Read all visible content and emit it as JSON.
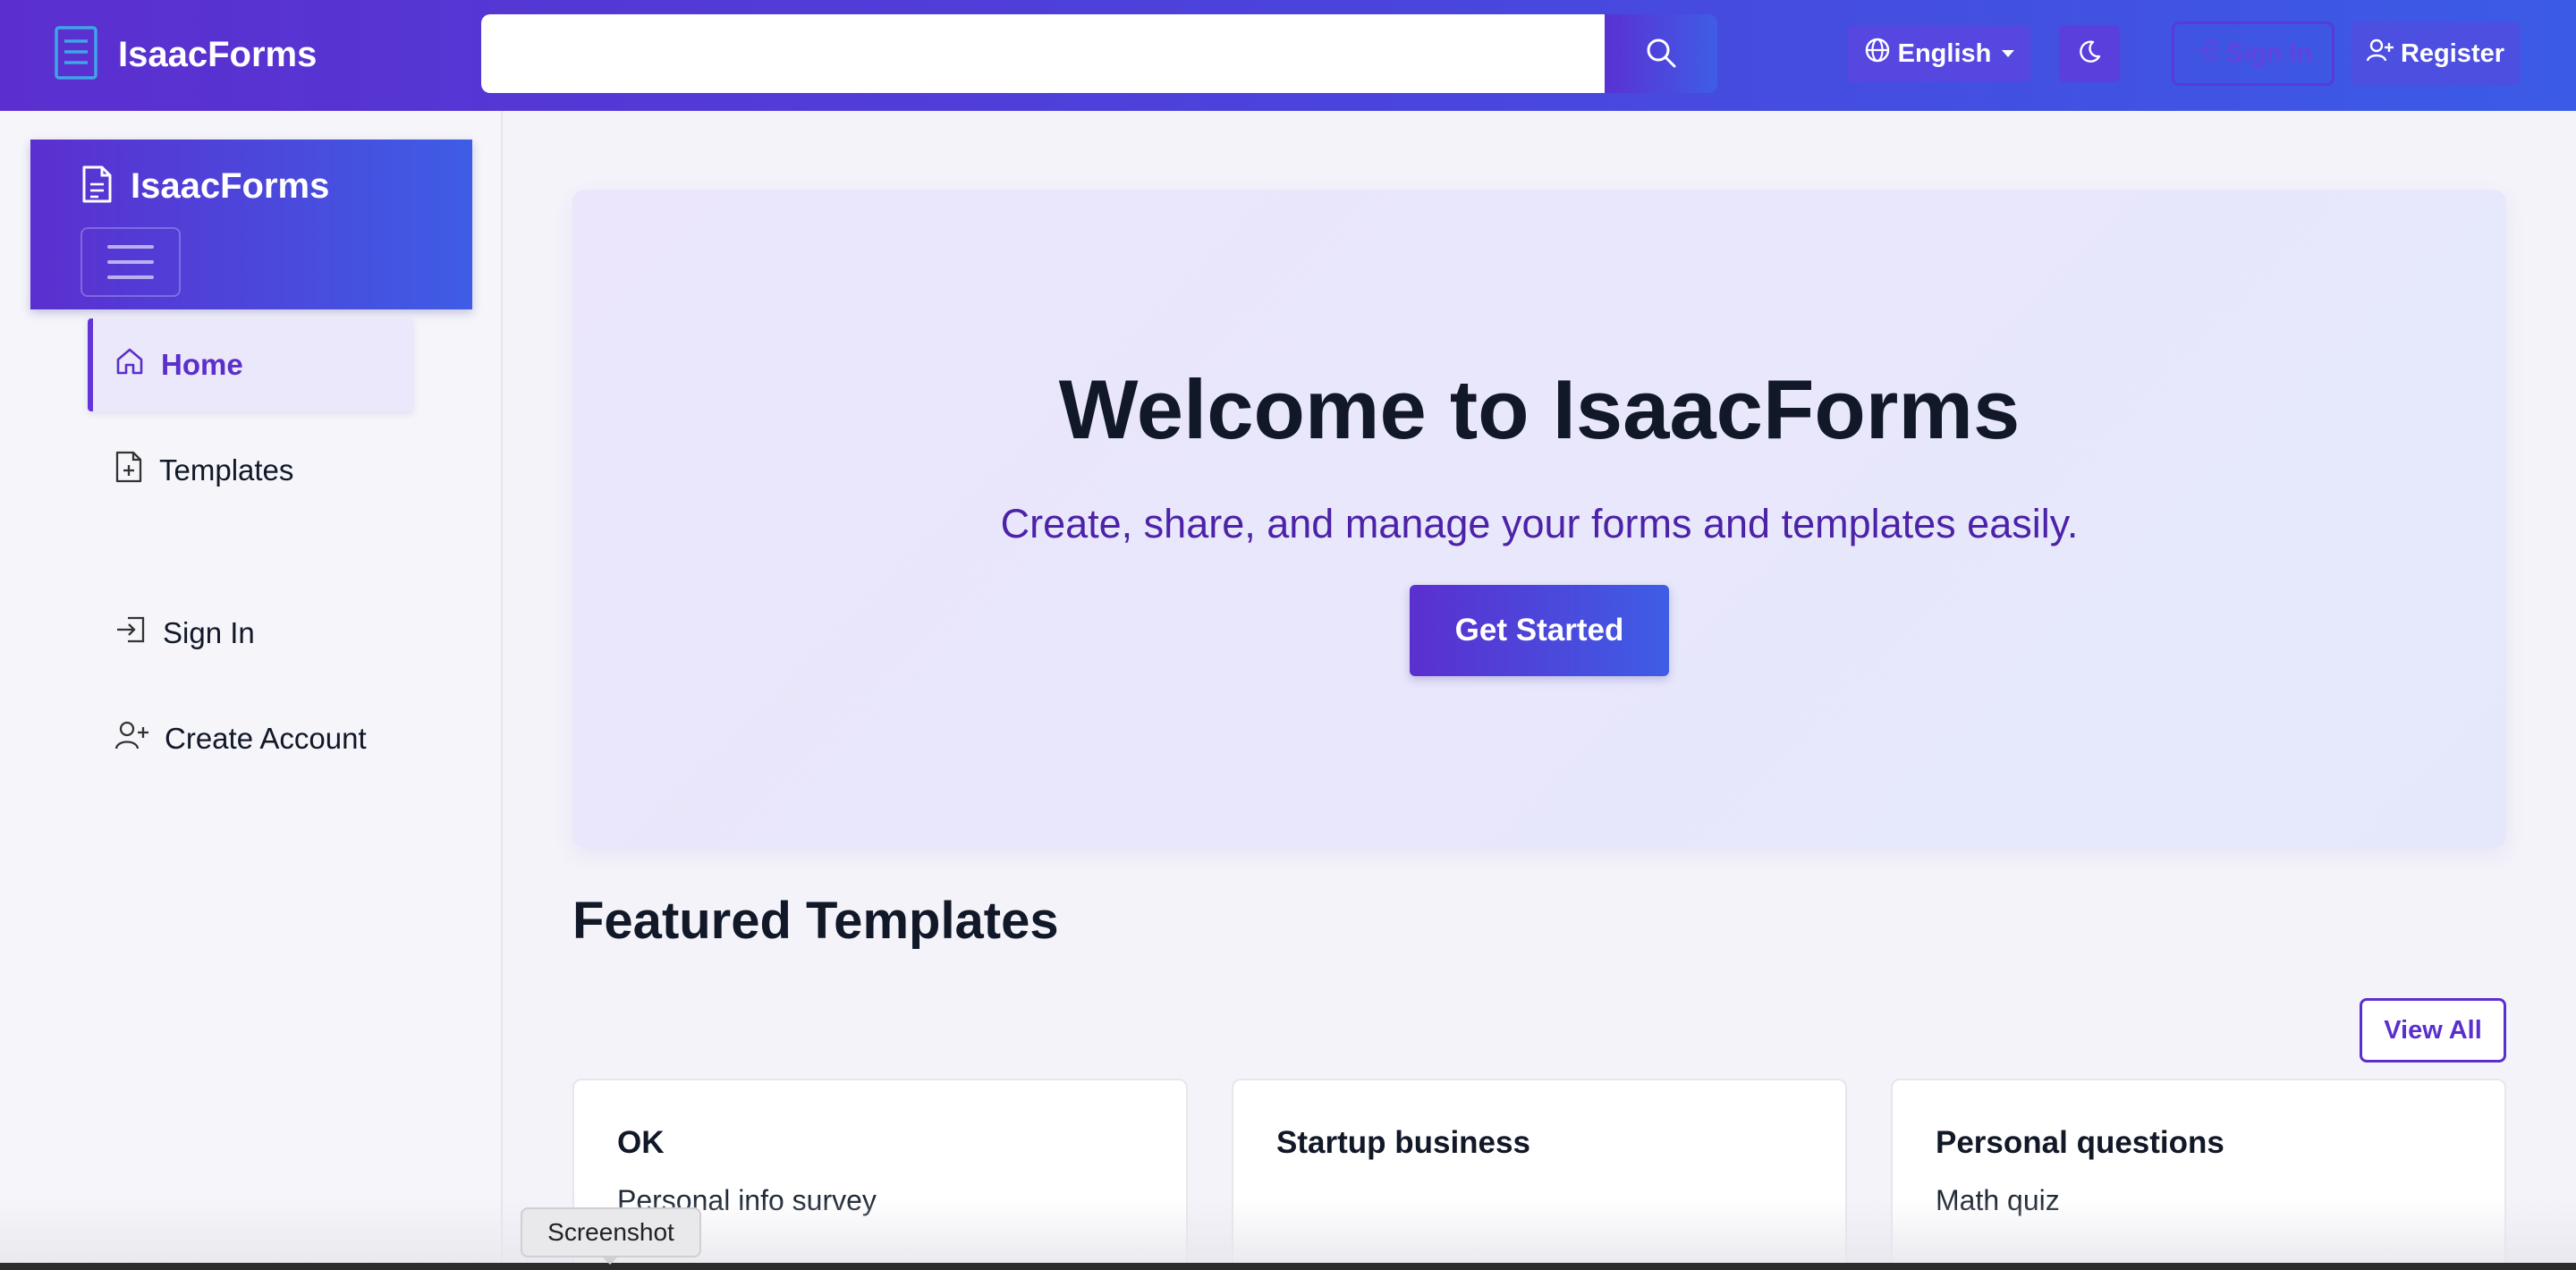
{
  "navbar": {
    "brand": "IsaacForms",
    "search_placeholder": "",
    "language": "English",
    "sign_in": "Sign In",
    "register": "Register",
    "colors": {
      "gradient_start": "#5b2fcf",
      "gradient_end": "#3e5de6"
    }
  },
  "sidebar": {
    "brand": "IsaacForms",
    "items": [
      {
        "label": "Home",
        "icon": "home-icon",
        "active": true
      },
      {
        "label": "Templates",
        "icon": "file-plus-icon",
        "active": false
      },
      {
        "label": "Sign In",
        "icon": "sign-in-icon",
        "active": false
      },
      {
        "label": "Create Account",
        "icon": "user-plus-icon",
        "active": false
      }
    ]
  },
  "hero": {
    "title": "Welcome to IsaacForms",
    "subtitle": "Create, share, and manage your forms and templates easily.",
    "cta": "Get Started"
  },
  "featured": {
    "title": "Featured Templates",
    "view_all": "View All",
    "cards": [
      {
        "title": "OK",
        "description": "Personal info survey"
      },
      {
        "title": "Startup business",
        "description": ""
      },
      {
        "title": "Personal questions",
        "description": "Math quiz"
      }
    ]
  },
  "tooltip": "Screenshot"
}
